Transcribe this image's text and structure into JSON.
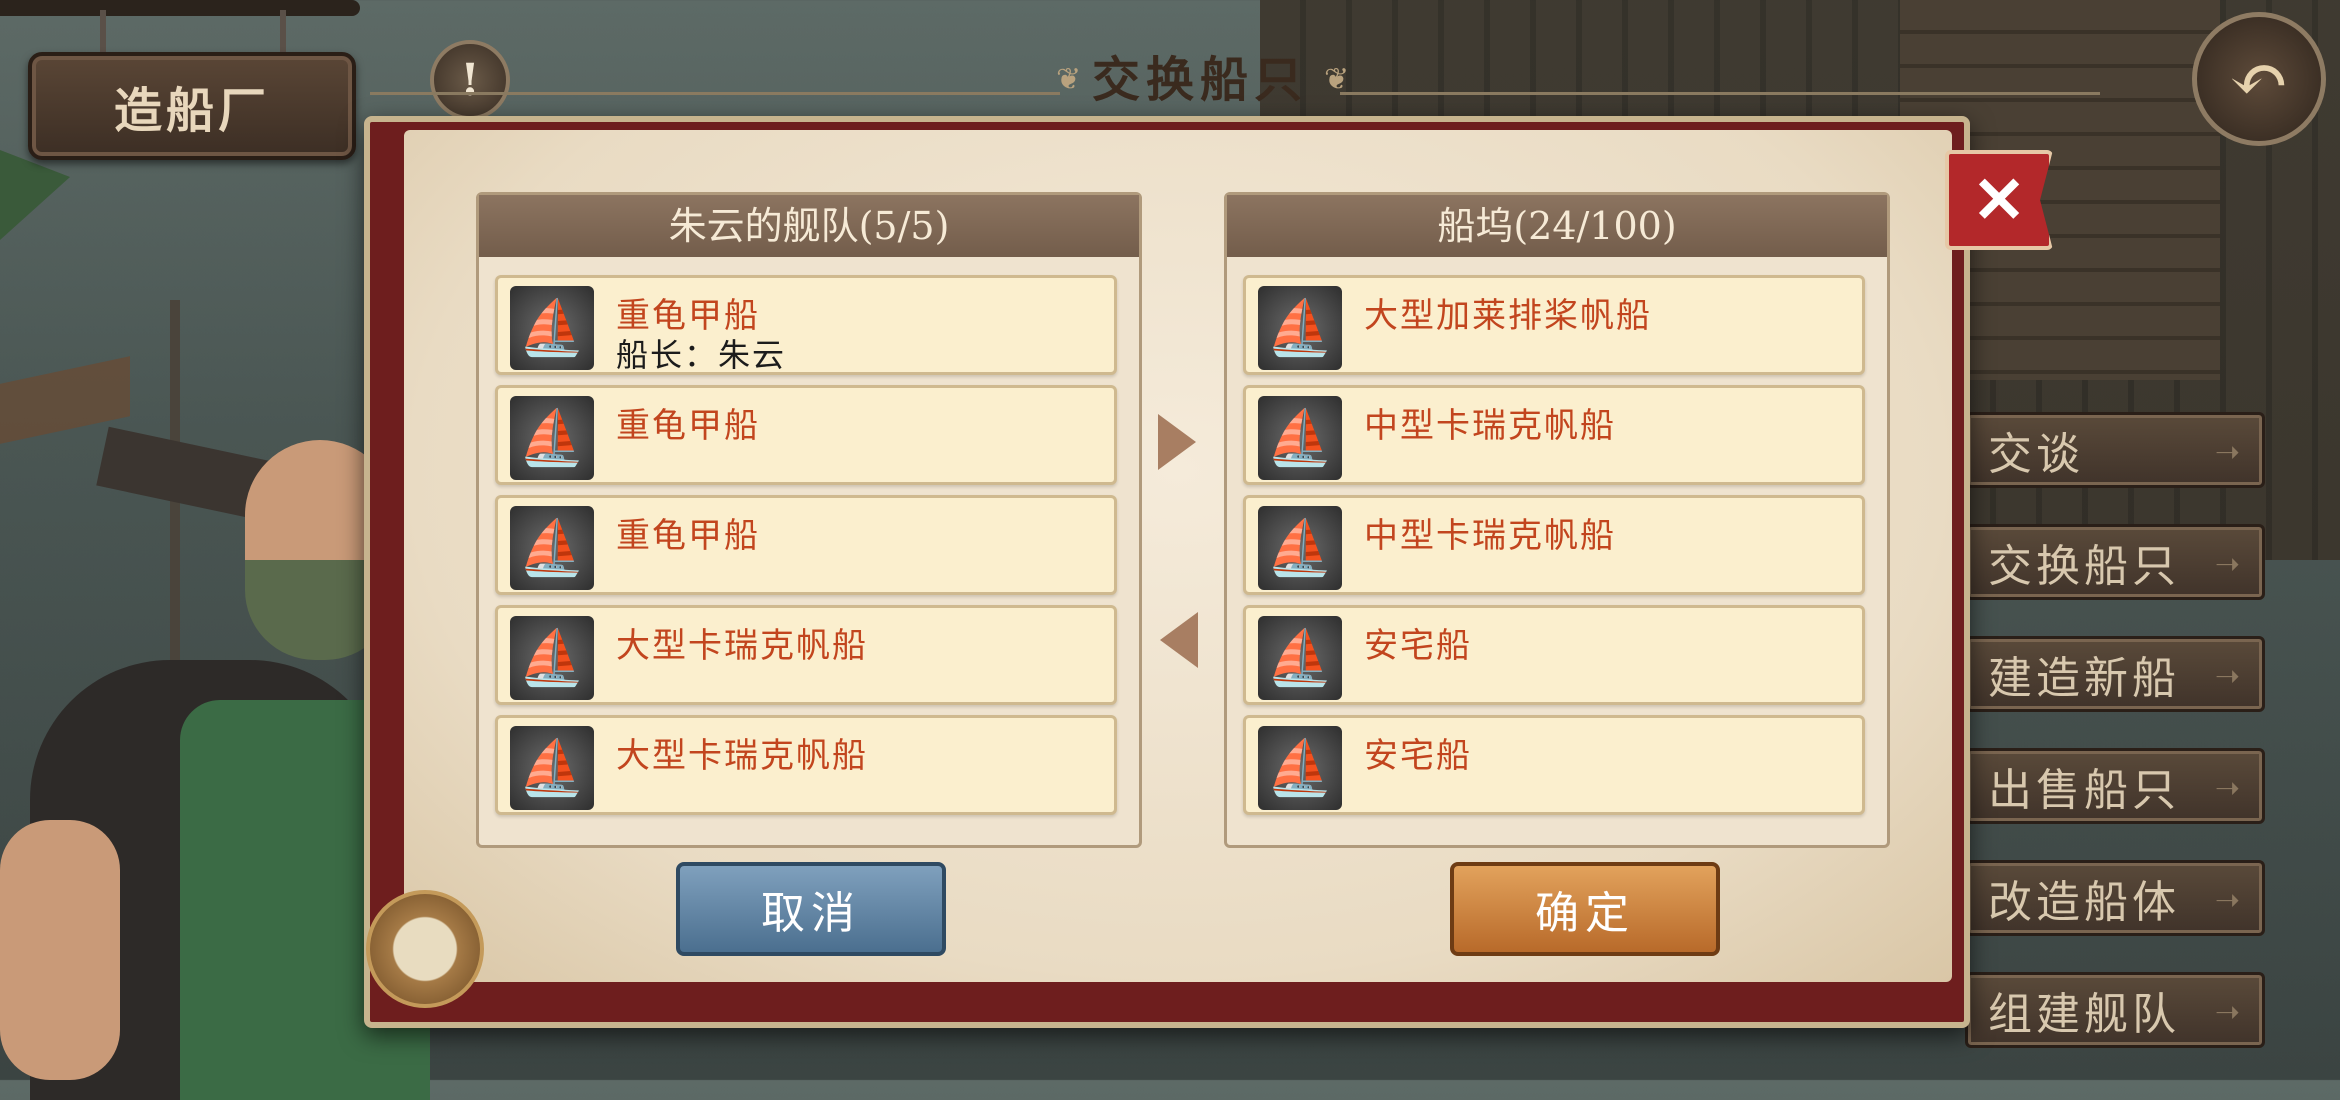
{
  "screen": {
    "location_sign": "造船厂",
    "info_icon": "exclamation-icon",
    "back_icon": "back-arrow-icon"
  },
  "dialog": {
    "title": "交换船只",
    "close_icon": "close-x-icon",
    "left_panel": {
      "header": "朱云的舰队(5/5)",
      "ships": [
        {
          "name": "重龟甲船",
          "captain": "船长：朱云",
          "type_icon": "junk-ship-icon"
        },
        {
          "name": "重龟甲船",
          "captain": "",
          "type_icon": "junk-ship-icon"
        },
        {
          "name": "重龟甲船",
          "captain": "",
          "type_icon": "junk-ship-icon"
        },
        {
          "name": "大型卡瑞克帆船",
          "captain": "",
          "type_icon": "carrack-ship-icon"
        },
        {
          "name": "大型卡瑞克帆船",
          "captain": "",
          "type_icon": "carrack-ship-icon"
        }
      ]
    },
    "right_panel": {
      "header": "船坞(24/100)",
      "ships": [
        {
          "name": "大型加莱排桨帆船",
          "type_icon": "galley-ship-icon"
        },
        {
          "name": "中型卡瑞克帆船",
          "type_icon": "carrack-ship-icon"
        },
        {
          "name": "中型卡瑞克帆船",
          "type_icon": "carrack-ship-icon"
        },
        {
          "name": "安宅船",
          "type_icon": "atakebune-ship-icon"
        },
        {
          "name": "安宅船",
          "type_icon": "atakebune-ship-icon"
        }
      ]
    },
    "cancel_label": "取消",
    "confirm_label": "确定"
  },
  "side_menu": {
    "items": [
      "交谈",
      "交换船只",
      "建造新船",
      "出售船只",
      "改造船体",
      "组建舰队"
    ]
  },
  "colors": {
    "dialog_frame": "#6e1e1e",
    "ship_name": "#c2451e",
    "cancel_button": "#5b7fa0",
    "confirm_button": "#c97c38"
  }
}
